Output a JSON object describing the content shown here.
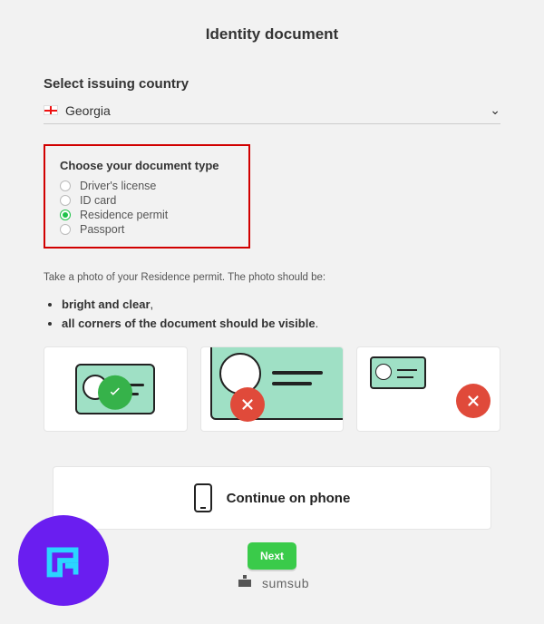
{
  "page_title": "Identity document",
  "country_section": {
    "label": "Select issuing country",
    "selected": "Georgia"
  },
  "doc_type_section": {
    "title": "Choose your document type",
    "options": [
      {
        "label": "Driver's license",
        "checked": false
      },
      {
        "label": "ID card",
        "checked": false
      },
      {
        "label": "Residence permit",
        "checked": true
      },
      {
        "label": "Passport",
        "checked": false
      }
    ]
  },
  "instruction": "Take a photo of your Residence permit. The photo should be:",
  "requirements": [
    "bright and clear",
    "all corners of the document should be visible"
  ],
  "continue_label": "Continue on phone",
  "next_label": "Next",
  "provider_name": "sumsub",
  "colors": {
    "accent_green": "#3acb4a",
    "error_red": "#e04a3a",
    "highlight_border": "#d10000",
    "brand_purple": "#6a1ef0"
  }
}
